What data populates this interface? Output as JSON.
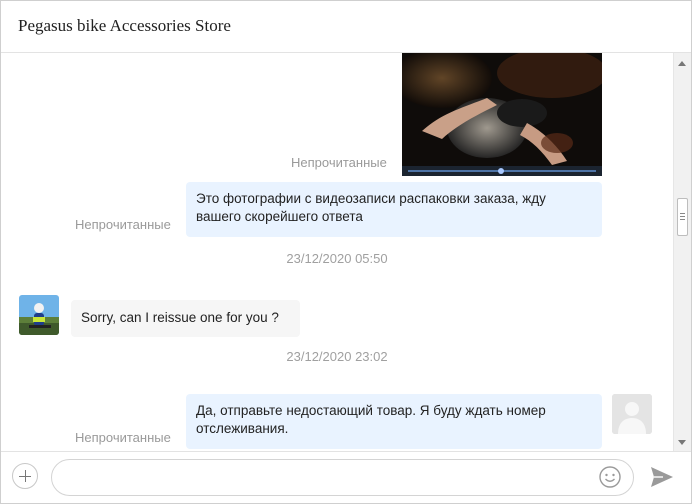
{
  "window": {
    "title": "Pegasus bike Accessories Store"
  },
  "messages": [
    {
      "kind": "outgoing-image",
      "status": "Непрочитанные"
    },
    {
      "kind": "outgoing-text",
      "status": "Непрочитанные",
      "text": "Это фотографии с видеозаписи распаковки заказа, жду вашего скорейшего ответа"
    },
    {
      "kind": "timestamp",
      "text": "23/12/2020 05:50"
    },
    {
      "kind": "incoming-text",
      "text": "Sorry, can I reissue one for you ?"
    },
    {
      "kind": "timestamp",
      "text": "23/12/2020 23:02"
    },
    {
      "kind": "outgoing-text",
      "status": "Непрочитанные",
      "text": "Да, отправьте недостающий товар. Я буду ждать номер отслеживания."
    }
  ],
  "composer": {
    "value": "",
    "placeholder": ""
  },
  "icons": {
    "attach": "plus-circle-icon",
    "emoji": "smiley-icon",
    "send": "paper-plane-icon",
    "seller_avatar": "cyclist-avatar",
    "user_avatar": "default-user-avatar"
  },
  "colors": {
    "outgoing_bubble": "#e9f3ff",
    "incoming_bubble": "#f6f6f6",
    "status_text": "#9a9a9a"
  }
}
